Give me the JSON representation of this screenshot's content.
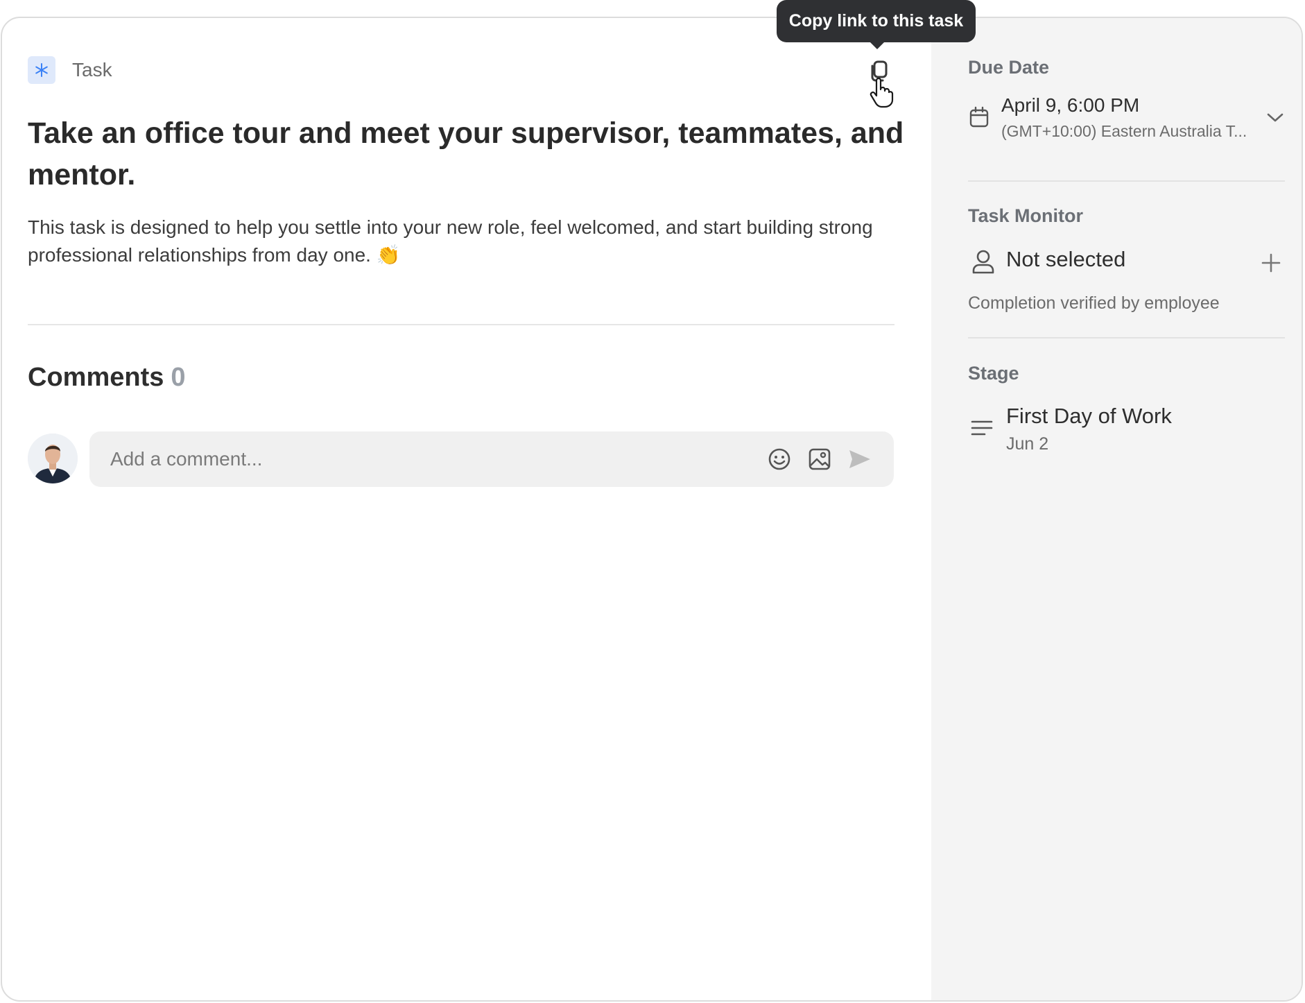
{
  "header": {
    "type_label": "Task",
    "copy_tooltip": "Copy link to this task"
  },
  "task": {
    "title": "Take an office tour and meet your supervisor, teammates, and mentor.",
    "description": "This task is designed to help you settle into your new role, feel welcomed, and start building strong professional relationships from day one. 👏"
  },
  "comments": {
    "heading": "Comments",
    "count": "0",
    "input_placeholder": "Add a comment..."
  },
  "sidebar": {
    "due_date": {
      "label": "Due Date",
      "date": "April 9, 6:00 PM",
      "timezone": "(GMT+10:00) Eastern Australia T..."
    },
    "task_monitor": {
      "label": "Task Monitor",
      "value": "Not selected",
      "note": "Completion verified by employee"
    },
    "stage": {
      "label": "Stage",
      "name": "First Day of Work",
      "date": "Jun 2"
    }
  },
  "icons": {
    "task_type": "asterisk-icon",
    "copy": "copy-icon",
    "emoji": "emoji-icon",
    "image": "image-icon",
    "send": "send-icon",
    "calendar": "calendar-icon",
    "chevron": "chevron-down-icon",
    "user": "user-icon",
    "add": "plus-icon",
    "stage": "lines-icon"
  },
  "colors": {
    "accent": "#3b82f6",
    "sidebar_bg": "#f4f4f4",
    "tooltip_bg": "#2f3033"
  }
}
